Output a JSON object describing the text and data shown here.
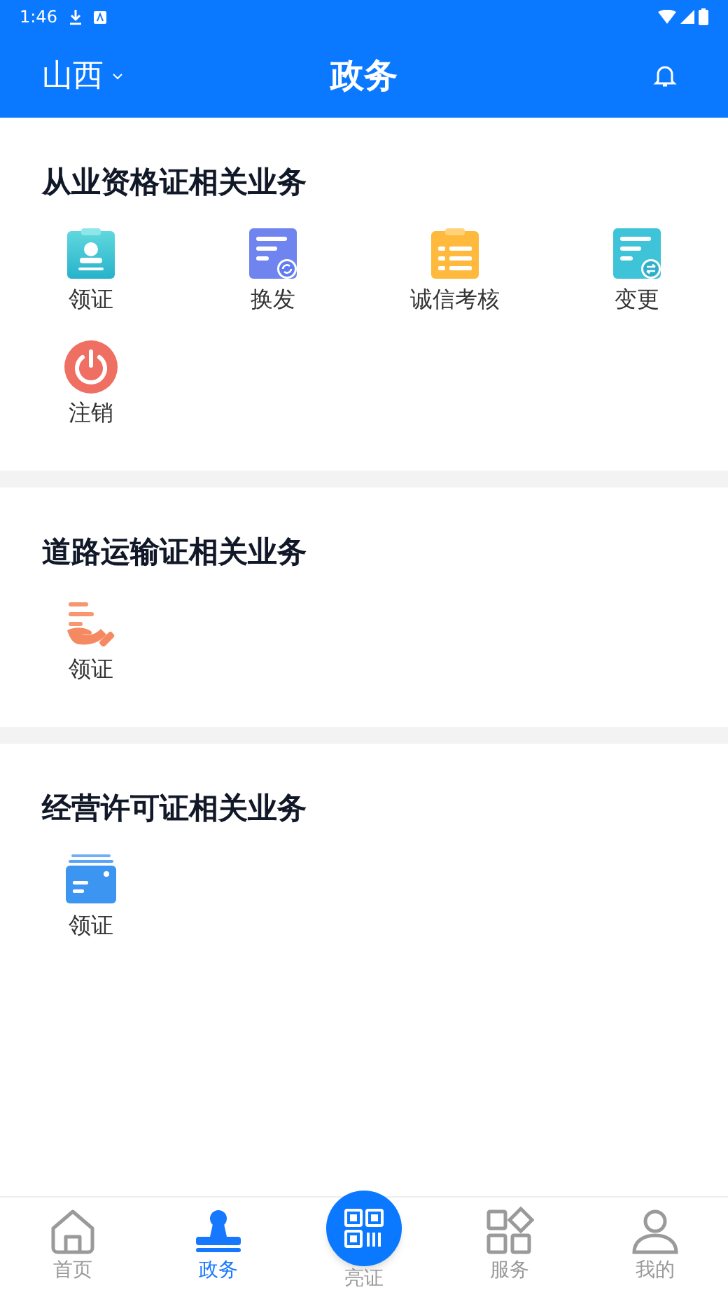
{
  "status_bar": {
    "time": "1:46"
  },
  "header": {
    "region": "山西",
    "title": "政务"
  },
  "sections": [
    {
      "title": "从业资格证相关业务",
      "items": [
        {
          "label": "领证",
          "kind": "badge"
        },
        {
          "label": "换发",
          "kind": "renew"
        },
        {
          "label": "诚信考核",
          "kind": "list"
        },
        {
          "label": "变更",
          "kind": "change"
        },
        {
          "label": "注销",
          "kind": "power"
        }
      ]
    },
    {
      "title": "道路运输证相关业务",
      "items": [
        {
          "label": "领证",
          "kind": "hand"
        }
      ]
    },
    {
      "title": "经营许可证相关业务",
      "items": [
        {
          "label": "领证",
          "kind": "card"
        }
      ]
    }
  ],
  "bottom_nav": [
    {
      "label": "首页",
      "kind": "home",
      "selected": false
    },
    {
      "label": "政务",
      "kind": "stamp",
      "selected": true
    },
    {
      "label": "亮证",
      "kind": "qr",
      "selected": false
    },
    {
      "label": "服务",
      "kind": "apps",
      "selected": false
    },
    {
      "label": "我的",
      "kind": "user",
      "selected": false
    }
  ]
}
